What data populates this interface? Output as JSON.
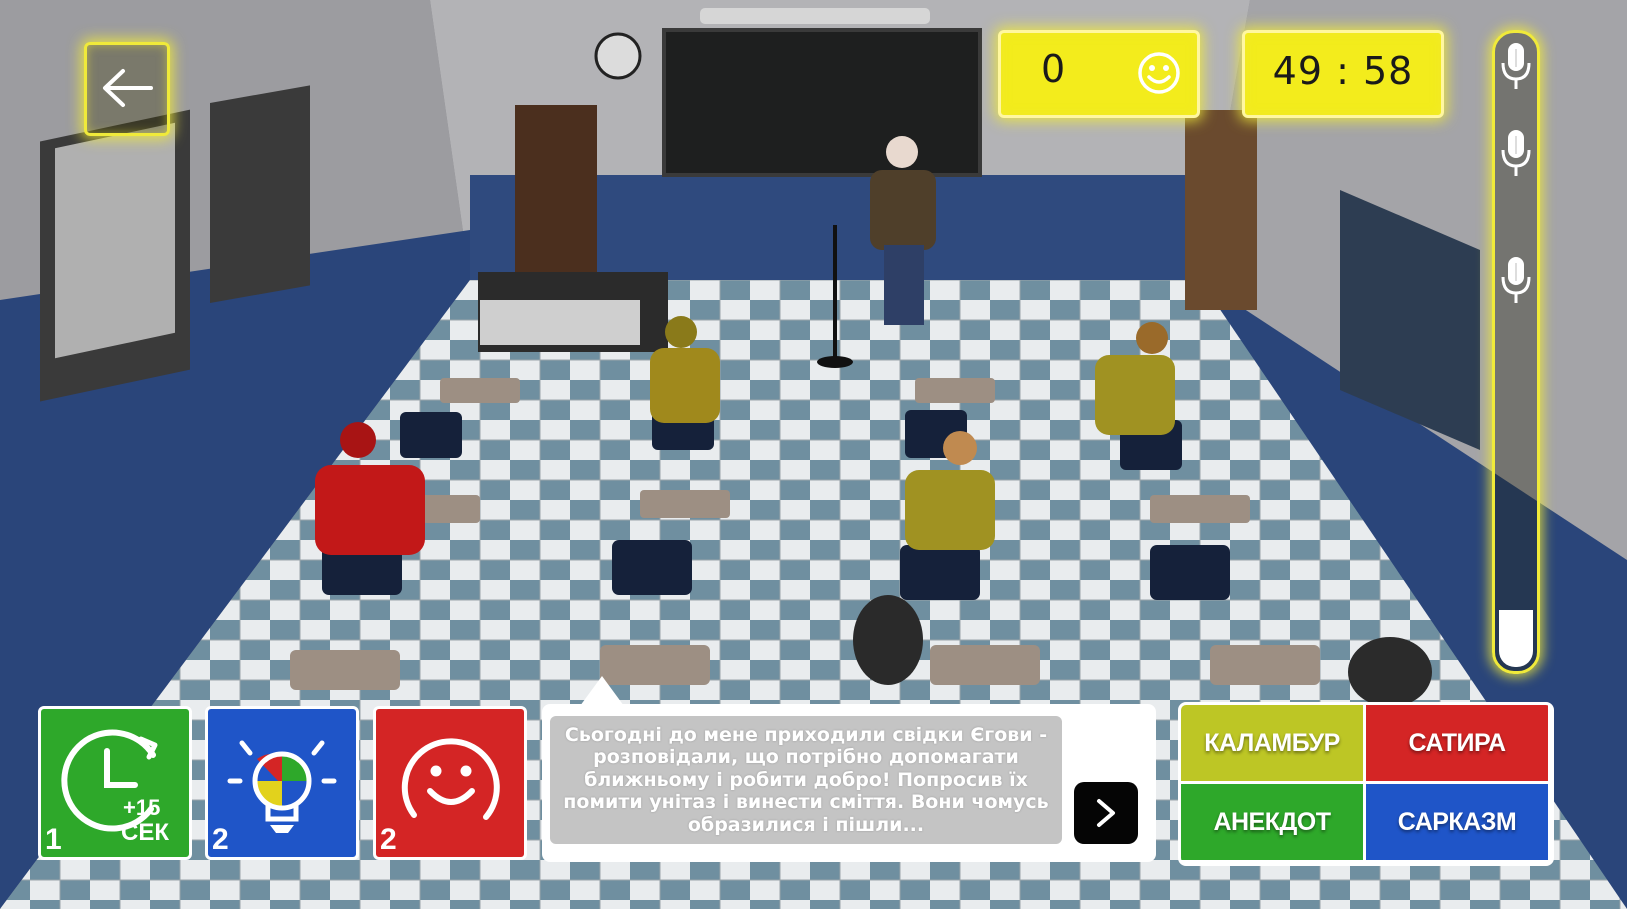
{
  "hud": {
    "score": "0",
    "timer": "49 : 58",
    "mic_level_percent": 9,
    "mic_markers": 3
  },
  "powerups": [
    {
      "id": "extra-time",
      "icon": "stopwatch-icon",
      "label_line1": "+15",
      "label_line2": "СЕК",
      "count": "1",
      "color": "#2ea82a"
    },
    {
      "id": "hint",
      "icon": "lightbulb-icon",
      "count": "2",
      "color": "#1f55c8"
    },
    {
      "id": "joke",
      "icon": "smile-icon",
      "count": "2",
      "color": "#d42525"
    }
  ],
  "joke_panel": {
    "text": "Сьогодні до мене приходили свідки Єгови - розповідали, що потрібно допомагати ближньому і робити добро! Попросив їх помити унітаз і винести сміття. Вони чомусь образилися і пішли..."
  },
  "genres": {
    "pun": "КАЛАМБУР",
    "satire": "САТИРА",
    "joke": "АНЕКДОТ",
    "sarcasm": "САРКАЗМ"
  },
  "colors": {
    "hud_yellow": "#f3ec1c",
    "neon_outline": "#f0ea3a",
    "green": "#2ea82a",
    "blue": "#1f55c8",
    "red": "#d42525",
    "olive": "#bdc625"
  }
}
